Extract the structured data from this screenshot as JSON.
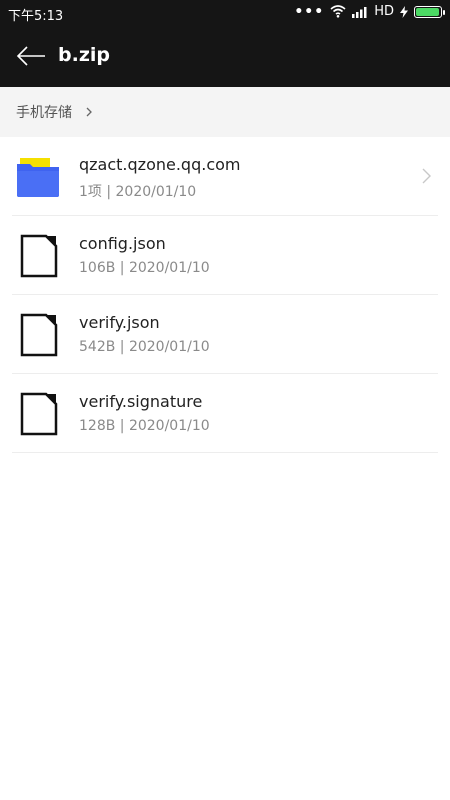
{
  "status_bar": {
    "time": "下午5:13",
    "dots": "•••",
    "network": "HD"
  },
  "toolbar": {
    "title": "b.zip",
    "back_icon": "back-arrow-icon"
  },
  "breadcrumb": {
    "label": "手机存储"
  },
  "items": [
    {
      "type": "folder",
      "icon": "folder-icon",
      "name": "qzact.qzone.qq.com",
      "meta": "1项 | 2020/01/10"
    },
    {
      "type": "file",
      "icon": "file-icon",
      "name": "config.json",
      "meta": "106B | 2020/01/10"
    },
    {
      "type": "file",
      "icon": "file-icon",
      "name": "verify.json",
      "meta": "542B | 2020/01/10"
    },
    {
      "type": "file",
      "icon": "file-icon",
      "name": "verify.signature",
      "meta": "128B | 2020/01/10"
    }
  ],
  "colors": {
    "header_bg": "#151515",
    "breadcrumb_bg": "#f4f4f4",
    "folder_blue": "#3f63f0",
    "folder_tab_yellow": "#f5e000",
    "battery_green": "#4cd964"
  }
}
